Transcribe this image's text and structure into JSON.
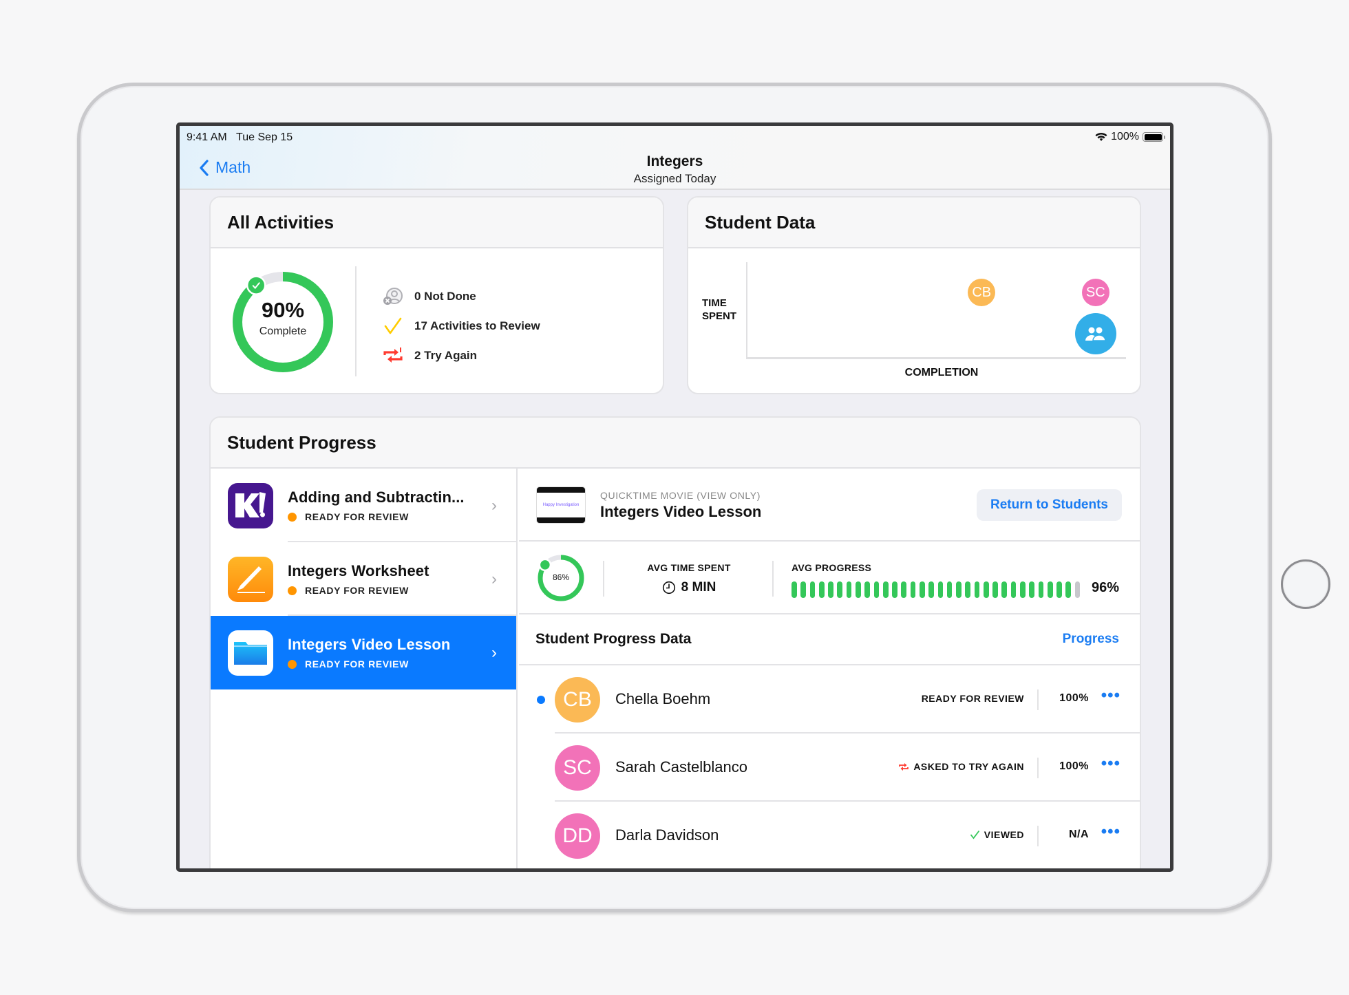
{
  "status_bar": {
    "time": "9:41 AM",
    "date": "Tue Sep 15",
    "battery": "100%"
  },
  "nav": {
    "back_label": "Math",
    "title": "Integers",
    "subtitle": "Assigned Today"
  },
  "all_activities": {
    "title": "All Activities",
    "completion_percent": 90,
    "completion_text": "90%",
    "completion_label": "Complete",
    "stats": [
      {
        "icon": "person-x-icon",
        "label": "0 Not Done"
      },
      {
        "icon": "checkmark-icon",
        "label": "17 Activities to Review"
      },
      {
        "icon": "try-again-icon",
        "label": "2 Try Again"
      }
    ]
  },
  "student_data": {
    "title": "Student Data",
    "y_label_line1": "TIME",
    "y_label_line2": "SPENT",
    "x_label": "COMPLETION",
    "points": [
      {
        "initials": "CB",
        "completion": 0.62,
        "time": 0.68,
        "color": "#fbb955"
      },
      {
        "initials": "SC",
        "completion": 0.92,
        "time": 0.68,
        "color": "#f272b8"
      },
      {
        "initials": "",
        "icon": "group-icon",
        "completion": 0.92,
        "time": 0.25,
        "color": "#32aee8"
      }
    ]
  },
  "student_progress": {
    "title": "Student Progress",
    "activities": [
      {
        "name": "Adding and Subtractin...",
        "status": "READY FOR REVIEW",
        "icon": "kahoot-icon",
        "selected": false
      },
      {
        "name": "Integers Worksheet",
        "status": "READY FOR REVIEW",
        "icon": "pages-icon",
        "selected": false
      },
      {
        "name": "Integers Video Lesson",
        "status": "READY FOR REVIEW",
        "icon": "files-icon",
        "selected": true
      }
    ],
    "detail": {
      "type_label": "QUICKTIME MOVIE  (VIEW ONLY)",
      "name": "Integers Video Lesson",
      "thumbnail_text": "Happy Investigation",
      "return_button": "Return to Students",
      "completion_percent": 86,
      "completion_text": "86%",
      "avg_time_label": "AVG TIME SPENT",
      "avg_time_value": "8 MIN",
      "avg_progress_label": "AVG PROGRESS",
      "avg_progress_percent": 96,
      "avg_progress_text": "96%",
      "progress_data_title": "Student Progress Data",
      "progress_link": "Progress",
      "students": [
        {
          "initials": "CB",
          "name": "Chella Boehm",
          "status": "READY FOR REVIEW",
          "status_icon": "",
          "percent": "100%",
          "color": "#fbb955",
          "unread": true
        },
        {
          "initials": "SC",
          "name": "Sarah Castelblanco",
          "status": "ASKED TO TRY AGAIN",
          "status_icon": "try-again-icon",
          "percent": "100%",
          "color": "#f272b8",
          "unread": false
        },
        {
          "initials": "DD",
          "name": "Darla Davidson",
          "status": "VIEWED",
          "status_icon": "checkmark-icon",
          "percent": "N/A",
          "color": "#f272b8",
          "unread": false
        }
      ]
    }
  },
  "colors": {
    "accent": "#1a7cf2",
    "selected_row": "#0a7aff",
    "ring_green": "#34c759",
    "ready_dot": "#ff9500",
    "try_again": "#ff3b30",
    "review_check": "#ffcc00"
  }
}
